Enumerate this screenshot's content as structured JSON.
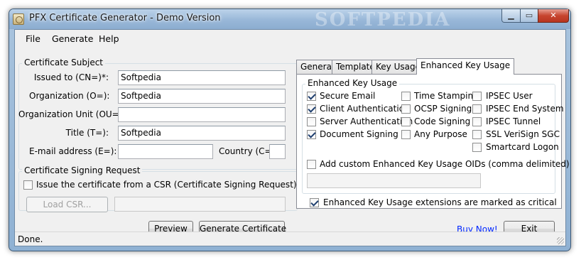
{
  "window": {
    "title": "PFX Certificate Generator - Demo Version",
    "watermark": "SOFTPEDIA"
  },
  "menu": {
    "items": [
      "File",
      "Generate",
      "Help"
    ]
  },
  "subject": {
    "group_title": "Certificate Subject",
    "issued_to_label": "Issued to (CN=)*:",
    "issued_to_value": "Softpedia",
    "organization_label": "Organization (O=):",
    "organization_value": "Softpedia",
    "org_unit_label": "Organization Unit (OU=):",
    "org_unit_value": "",
    "title_label": "Title (T=):",
    "title_value": "Softpedia",
    "email_label": "E-mail address (E=):",
    "email_value": "",
    "country_label": "Country (C=):",
    "country_value": ""
  },
  "csr": {
    "group_title": "Certificate Signing Request",
    "checkbox_label": "Issue the certificate from a CSR (Certificate Signing Request) file",
    "checked": false,
    "load_button": "Load CSR...",
    "path_value": ""
  },
  "buttons": {
    "preview": "Preview",
    "generate": "Generate Certificate",
    "buy_now": "Buy Now!",
    "exit": "Exit"
  },
  "tabs": {
    "items": [
      "General",
      "Template",
      "Key Usage",
      "Enhanced Key Usage"
    ],
    "active": "Enhanced Key Usage"
  },
  "eku": {
    "group_title": "Enhanced Key Usage",
    "col1": [
      {
        "label": "Secure Email",
        "checked": true
      },
      {
        "label": "Client Authentication",
        "checked": true
      },
      {
        "label": "Server Authentication",
        "checked": false
      },
      {
        "label": "Document Signing",
        "checked": true
      }
    ],
    "col2": [
      {
        "label": "Time Stamping",
        "checked": false
      },
      {
        "label": "OCSP Signing",
        "checked": false
      },
      {
        "label": "Code Signing",
        "checked": false
      },
      {
        "label": "Any Purpose",
        "checked": false
      }
    ],
    "col3": [
      {
        "label": "IPSEC User",
        "checked": false
      },
      {
        "label": "IPSEC End System",
        "checked": false
      },
      {
        "label": "IPSEC Tunnel",
        "checked": false
      },
      {
        "label": "SSL VeriSign SGC",
        "checked": false
      },
      {
        "label": "Smartcard Logon",
        "checked": false
      }
    ],
    "custom_label": "Add custom Enhanced Key Usage OIDs (comma delimited)",
    "custom_checked": false,
    "custom_value": "",
    "critical_label": "Enhanced Key Usage extensions are marked as critical",
    "critical_checked": true
  },
  "status": {
    "text": "Done."
  }
}
